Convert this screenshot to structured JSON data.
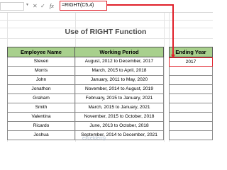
{
  "formula_bar": {
    "cancel_icon": "✕",
    "enter_icon": "✓",
    "fx_label": "fx",
    "formula": "=RIGHT(C5,4)"
  },
  "sheet": {
    "title": "Use of RIGHT Function"
  },
  "table": {
    "headers": {
      "name": "Employee Name",
      "period": "Working Period",
      "year": "Ending Year"
    },
    "rows": [
      {
        "name": "Steven",
        "period": "August, 2012 to December, 2017",
        "year": "2017"
      },
      {
        "name": "Morris",
        "period": "March, 2015 to April, 2018",
        "year": ""
      },
      {
        "name": "John",
        "period": "January, 2011 to May, 2020",
        "year": ""
      },
      {
        "name": "Jonathon",
        "period": "November, 2014 to August, 2019",
        "year": ""
      },
      {
        "name": "Graham",
        "period": "February, 2015 to January, 2021",
        "year": ""
      },
      {
        "name": "Smith",
        "period": "March, 2015 to January, 2021",
        "year": ""
      },
      {
        "name": "Valentina",
        "period": "November, 2015 to October, 2018",
        "year": ""
      },
      {
        "name": "Ricardo",
        "period": "June, 2013 to October, 2018",
        "year": ""
      },
      {
        "name": "Joshua",
        "period": "September, 2014 to December, 2021",
        "year": ""
      }
    ]
  },
  "watermark": "exceldemy",
  "colors": {
    "header_fill": "#a8d08d",
    "highlight_red": "#e0202a",
    "title_gray": "#4a4a4a"
  }
}
